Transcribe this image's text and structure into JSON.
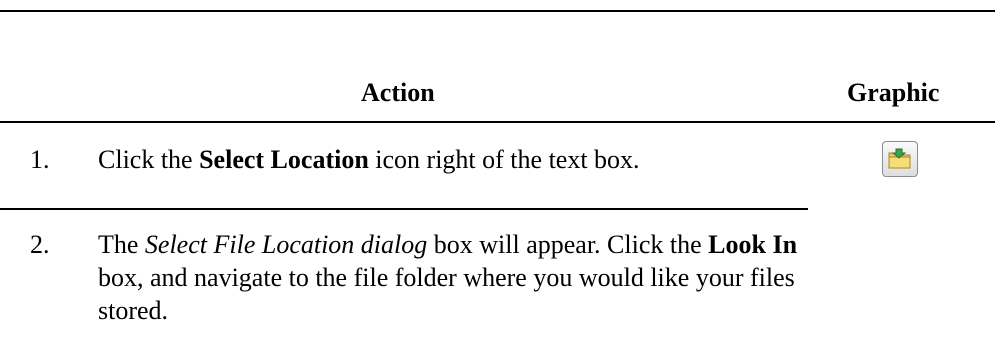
{
  "table": {
    "headers": {
      "action": "Action",
      "graphic": "Graphic"
    },
    "rows": [
      {
        "number": "1.",
        "parts": [
          "Click the ",
          "Select Location",
          " icon right of the text box."
        ],
        "graphic_icon": "select-location-folder-icon"
      },
      {
        "number": "2.",
        "parts": [
          "The ",
          "Select File Location dialog",
          " box will appear. Click the ",
          "Look In",
          " box, and navigate to the file folder where you would like your files stored."
        ]
      }
    ]
  },
  "colors": {
    "icon_folder": "#f2c94c",
    "icon_arrow": "#3fa34d"
  }
}
